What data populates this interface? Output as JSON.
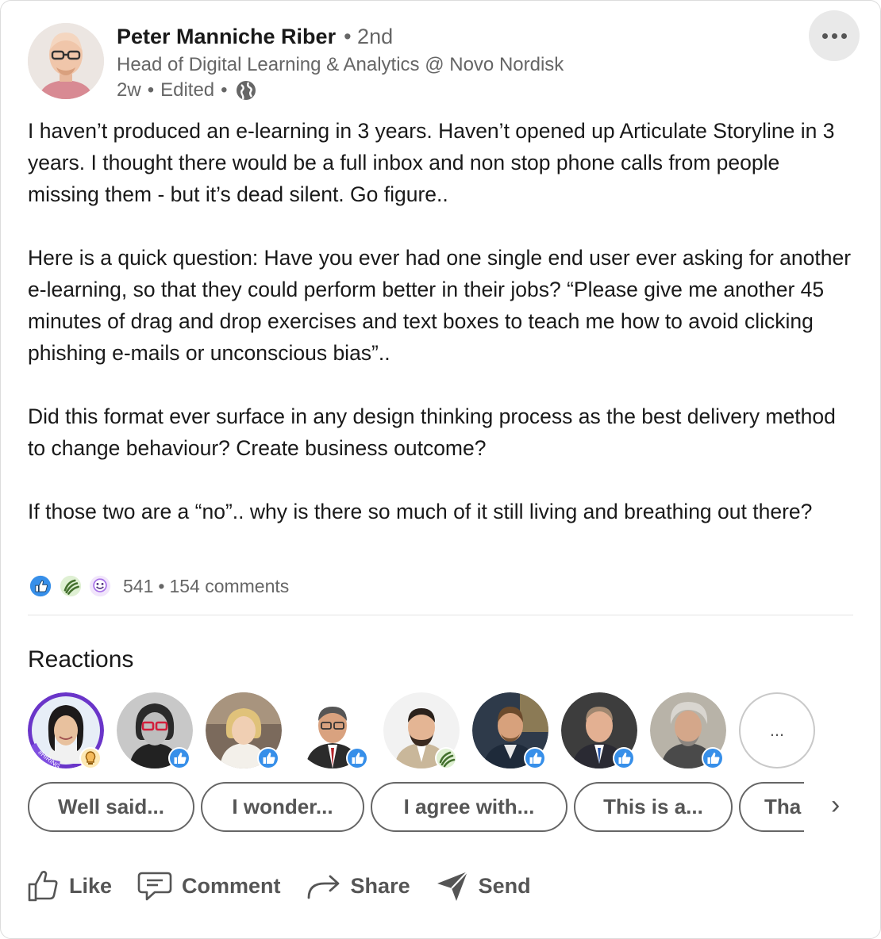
{
  "author": {
    "name": "Peter Manniche Riber",
    "degree": "2nd",
    "headline": "Head of Digital Learning & Analytics @ Novo Nordisk",
    "time": "2w",
    "edited": "Edited",
    "avatar_icon": "profile-photo"
  },
  "menu": {
    "icon": "more-options-icon"
  },
  "post": {
    "paragraphs": [
      "I haven’t produced an e-learning in 3 years. Haven’t opened up Articulate Storyline in 3 years. I thought there would be a full inbox and non stop phone calls from people missing them - but it’s dead silent. Go figure..",
      "Here is a quick question: Have you ever had one single end user ever asking for another e-learning, so that they could perform better in their jobs? “Please give me another 45 minutes of drag and drop exercises and text boxes to teach me how to avoid clicking phishing e-mails or unconscious bias”..",
      "Did this format ever surface in any design thinking process as the best delivery method to change behaviour? Create business outcome?",
      "If those two are a “no”.. why is there so much of it still living and breathing out there?"
    ]
  },
  "social": {
    "reaction_count": "541",
    "comments": "154 comments",
    "reaction_icons": [
      "like-icon",
      "celebrate-icon",
      "funny-icon"
    ]
  },
  "reactions": {
    "title": "Reactions",
    "more_label": "...",
    "people": [
      {
        "badge": "insightful-icon",
        "hiring_tag": "#HIRING"
      },
      {
        "badge": "like-icon"
      },
      {
        "badge": "like-icon"
      },
      {
        "badge": "like-icon"
      },
      {
        "badge": "celebrate-icon"
      },
      {
        "badge": "like-icon"
      },
      {
        "badge": "like-icon"
      },
      {
        "badge": "like-icon"
      }
    ]
  },
  "quick_replies": [
    "Well said...",
    "I wonder...",
    "I agree with...",
    "This is a...",
    "Tha"
  ],
  "quick_replies_next": "›",
  "actions": {
    "like": "Like",
    "comment": "Comment",
    "share": "Share",
    "send": "Send"
  },
  "colors": {
    "like_blue": "#378fe9",
    "celebrate_green": "#44712e",
    "funny_purple": "#a872e8",
    "insight_yellow": "#f5bb5c"
  }
}
